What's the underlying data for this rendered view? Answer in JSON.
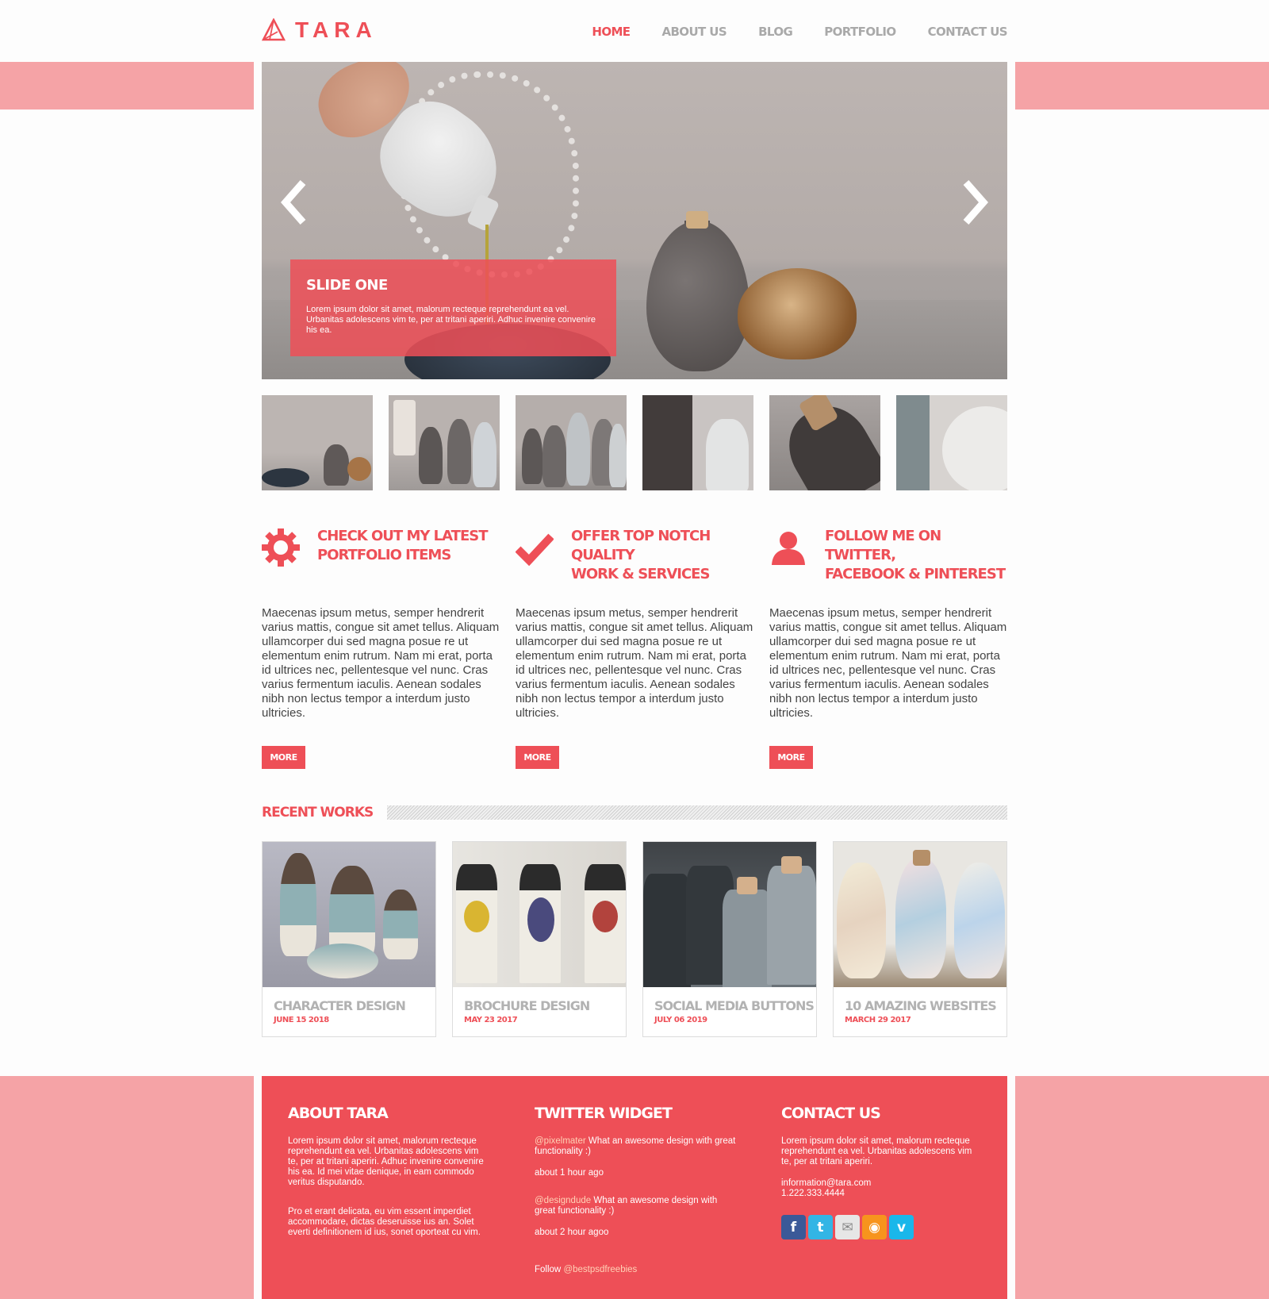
{
  "brand": {
    "name": "TARA",
    "accent": "#ee4f57",
    "band_color": "#f5a3a6"
  },
  "nav": [
    {
      "label": "HOME",
      "active": true
    },
    {
      "label": "ABOUT US",
      "active": false
    },
    {
      "label": "BLOG",
      "active": false
    },
    {
      "label": "PORTFOLIO",
      "active": false
    },
    {
      "label": "CONTACT US",
      "active": false
    }
  ],
  "slider": {
    "prev_icon": "chevron-left-icon",
    "next_icon": "chevron-right-icon",
    "caption_title": "SLIDE ONE",
    "caption_text": "Lorem ipsum dolor sit amet, malorum recteque reprehendunt ea vel. Urbanitas adolescens vim te, per at tritani aperiri. Adhuc invenire convenire his ea."
  },
  "features": [
    {
      "icon": "gear-icon",
      "title_line1": "CHECK OUT MY LATEST",
      "title_line2": "PORTFOLIO ITEMS",
      "text": "Maecenas ipsum metus, semper hendrerit varius mattis, congue sit amet tellus. Aliquam ullamcorper dui sed magna posue re ut elementum enim rutrum. Nam mi erat, porta id ultrices nec, pellentesque vel nunc. Cras varius fermentum iaculis. Aenean sodales nibh non lectus tempor a interdum justo ultricies.",
      "button": "MORE"
    },
    {
      "icon": "checkmark-icon",
      "title_line1": "OFFER TOP NOTCH QUALITY",
      "title_line2": "WORK & SERVICES",
      "text": "Maecenas ipsum metus, semper hendrerit varius mattis, congue sit amet tellus. Aliquam ullamcorper dui sed magna posue re ut elementum enim rutrum. Nam mi erat, porta id ultrices nec, pellentesque vel nunc. Cras varius fermentum iaculis. Aenean sodales nibh non lectus tempor a interdum justo ultricies.",
      "button": "MORE"
    },
    {
      "icon": "user-icon",
      "title_line1": "FOLLOW ME ON TWITTER,",
      "title_line2": "FACEBOOK & PINTEREST",
      "text": "Maecenas ipsum metus, semper hendrerit varius mattis, congue sit amet tellus. Aliquam ullamcorper dui sed magna posue re ut elementum enim rutrum. Nam mi erat, porta id ultrices nec, pellentesque vel nunc. Cras varius fermentum iaculis. Aenean sodales nibh non lectus tempor a interdum justo ultricies.",
      "button": "MORE"
    }
  ],
  "recent": {
    "heading": "RECENT WORKS",
    "items": [
      {
        "title": "CHARACTER DESIGN",
        "date": "JUNE 15 2018"
      },
      {
        "title": "BROCHURE DESIGN",
        "date": "MAY 23 2017"
      },
      {
        "title": "SOCIAL MEDIA BUTTONS",
        "date": "JULY 06 2019"
      },
      {
        "title": "10 AMAZING WEBSITES",
        "date": "MARCH 29 2017"
      }
    ]
  },
  "footer": {
    "about": {
      "title": "ABOUT TARA",
      "p1": "Lorem ipsum dolor sit amet, malorum recteque reprehendunt ea vel. Urbanitas adolescens vim te, per at tritani aperiri. Adhuc invenire convenire his ea. Id mei vitae denique, in eam commodo veritus disputando.",
      "p2": "Pro et erant delicata, eu vim essent imperdiet accommodare, dictas deseruisse ius an. Solet everti definitionem id ius, sonet oporteat cu vim."
    },
    "twitter": {
      "title": "TWITTER WIDGET",
      "tweets": [
        {
          "user": "@pixelmater",
          "text": " What an awesome design with great functionality :)",
          "time": "about 1 hour ago"
        },
        {
          "user": "@designdude",
          "text": " What an awesome design with great functionality :)",
          "time": "about 2 hour agoo"
        }
      ],
      "follow_label": "Follow ",
      "follow_user": "@bestpsdfreebies"
    },
    "contact": {
      "title": "CONTACT US",
      "text": "Lorem ipsum dolor sit amet, malorum recteque reprehendunt ea vel. Urbanitas adolescens vim te, per at tritani aperiri.",
      "email": "information@tara.com",
      "phone": "1.222.333.4444",
      "social": [
        {
          "icon": "facebook-icon",
          "glyph": "f",
          "color": "#3b5998"
        },
        {
          "icon": "twitter-icon",
          "glyph": "t",
          "color": "#33b5e5"
        },
        {
          "icon": "mail-icon",
          "glyph": "✉",
          "color": "#d9d9d9"
        },
        {
          "icon": "rss-icon",
          "glyph": "◉",
          "color": "#f7941d"
        },
        {
          "icon": "vimeo-icon",
          "glyph": "v",
          "color": "#1ab7ea"
        }
      ]
    }
  }
}
